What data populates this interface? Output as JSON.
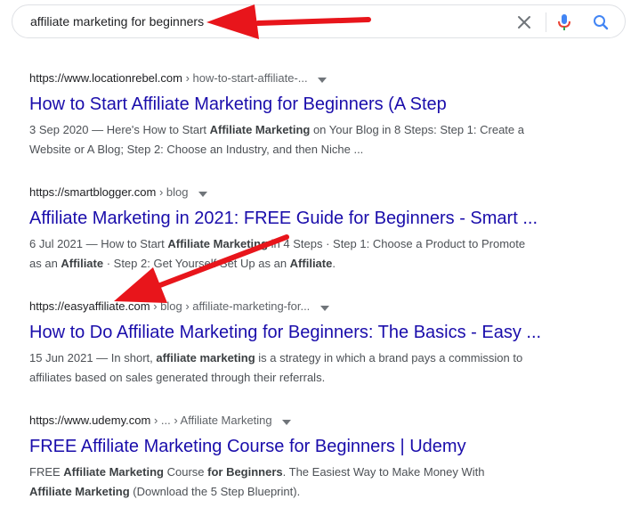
{
  "search": {
    "query": "affiliate marketing for beginners",
    "clear_icon": "close-icon",
    "voice_icon": "microphone-icon",
    "submit_icon": "search-icon"
  },
  "results": [
    {
      "site": "https://www.locationrebel.com",
      "path": "› how-to-start-affiliate-...",
      "title": "How to Start Affiliate Marketing for Beginners (A Step",
      "snippet_line1": [
        {
          "t": "3 Sep 2020 — Here's How to Start ",
          "b": false
        },
        {
          "t": "Affiliate Marketing",
          "b": true
        },
        {
          "t": " on Your Blog in 8 Steps: Step 1: Create a",
          "b": false
        }
      ],
      "snippet_line2": [
        {
          "t": "Website or A Blog; Step 2: Choose an Industry, and then Niche ...",
          "b": false
        }
      ]
    },
    {
      "site": "https://smartblogger.com",
      "path": "› blog",
      "title": "Affiliate Marketing in 2021: FREE Guide for Beginners - Smart ...",
      "snippet_line1": [
        {
          "t": "6 Jul 2021 — How to Start ",
          "b": false
        },
        {
          "t": "Affiliate Marketing",
          "b": true
        },
        {
          "t": " in 4 Steps · Step 1: Choose a Product to Promote",
          "b": false
        }
      ],
      "snippet_line2": [
        {
          "t": "as an ",
          "b": false
        },
        {
          "t": "Affiliate",
          "b": true
        },
        {
          "t": " · Step 2: Get Yourself Set Up as an ",
          "b": false
        },
        {
          "t": "Affiliate",
          "b": true
        },
        {
          "t": ".",
          "b": false
        }
      ]
    },
    {
      "site": "https://easyaffiliate.com",
      "path": "› blog › affiliate-marketing-for...",
      "title": "How to Do Affiliate Marketing for Beginners: The Basics - Easy ...",
      "snippet_line1": [
        {
          "t": "15 Jun 2021 — In short, ",
          "b": false
        },
        {
          "t": "affiliate marketing",
          "b": true
        },
        {
          "t": " is a strategy in which a brand pays a commission to",
          "b": false
        }
      ],
      "snippet_line2": [
        {
          "t": "affiliates based on sales generated through their referrals.",
          "b": false
        }
      ]
    },
    {
      "site": "https://www.udemy.com",
      "path": "› ... › Affiliate Marketing",
      "title": "FREE Affiliate Marketing Course for Beginners | Udemy",
      "snippet_line1": [
        {
          "t": "FREE ",
          "b": false
        },
        {
          "t": "Affiliate Marketing",
          "b": true
        },
        {
          "t": " Course ",
          "b": false
        },
        {
          "t": "for Beginners",
          "b": true
        },
        {
          "t": ". The Easiest Way to Make Money With",
          "b": false
        }
      ],
      "snippet_line2": [
        {
          "t": "Affiliate Marketing",
          "b": true
        },
        {
          "t": " (Download the 5 Step Blueprint).",
          "b": false
        }
      ]
    }
  ],
  "colors": {
    "link": "#1a0dab",
    "snippet": "#4d5156",
    "annotation_arrow": "#e8151b"
  }
}
